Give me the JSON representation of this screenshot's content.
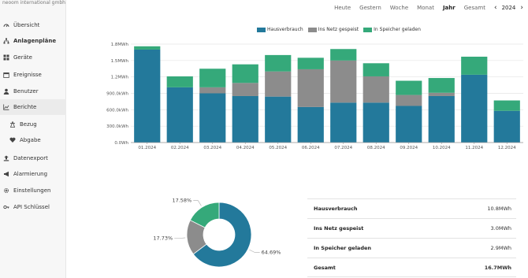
{
  "company": "neoom international gmbh",
  "nav": [
    {
      "label": "Übersicht",
      "icon": "gauge-icon",
      "name": "nav-uebersicht"
    },
    {
      "label": "Anlagenpläne",
      "icon": "sitemap-icon",
      "name": "nav-anlagenplaene",
      "bold": true
    },
    {
      "label": "Geräte",
      "icon": "grid-icon",
      "name": "nav-geraete"
    },
    {
      "label": "Ereignisse",
      "icon": "calendar-icon",
      "name": "nav-ereignisse"
    },
    {
      "label": "Benutzer",
      "icon": "user-icon",
      "name": "nav-benutzer"
    },
    {
      "label": "Berichte",
      "icon": "chart-icon",
      "name": "nav-berichte",
      "active": true
    },
    {
      "label": "Bezug",
      "icon": "tower-icon",
      "name": "nav-bezug",
      "sub": true
    },
    {
      "label": "Abgabe",
      "icon": "heart-icon",
      "name": "nav-abgabe",
      "sub": true
    },
    {
      "label": "Datenexport",
      "icon": "export-icon",
      "name": "nav-datenexport"
    },
    {
      "label": "Alarmierung",
      "icon": "megaphone-icon",
      "name": "nav-alarmierung"
    },
    {
      "label": "Einstellungen",
      "icon": "gear-icon",
      "name": "nav-einstellungen"
    },
    {
      "label": "API Schlüssel",
      "icon": "key-icon",
      "name": "nav-api-schluessel"
    }
  ],
  "period_tabs": [
    "Heute",
    "Gestern",
    "Woche",
    "Monat",
    "Jahr",
    "Gesamt"
  ],
  "active_tab": "Jahr",
  "year": "2024",
  "colors": {
    "hausverbrauch": "#23799b",
    "netz": "#8c8c8c",
    "speicher": "#35a97a"
  },
  "chart_data": {
    "type": "bar",
    "stacked": true,
    "categories": [
      "01.2024",
      "02.2024",
      "03.2024",
      "04.2024",
      "05.2024",
      "06.2024",
      "07.2024",
      "08.2024",
      "09.2024",
      "10.2024",
      "11.2024",
      "12.2024"
    ],
    "series": [
      {
        "name": "Hausverbrauch",
        "values": [
          1.7,
          1.01,
          0.9,
          0.85,
          0.84,
          0.65,
          0.73,
          0.73,
          0.67,
          0.85,
          1.24,
          0.58
        ]
      },
      {
        "name": "Ins Netz gespeist",
        "values": [
          0.0,
          0.0,
          0.11,
          0.24,
          0.46,
          0.69,
          0.77,
          0.48,
          0.2,
          0.06,
          0.0,
          0.0
        ]
      },
      {
        "name": "In Speicher geladen",
        "values": [
          0.06,
          0.2,
          0.34,
          0.34,
          0.3,
          0.21,
          0.21,
          0.24,
          0.26,
          0.27,
          0.33,
          0.19
        ]
      }
    ],
    "yticks": [
      "0.0Wh",
      "300.0kWh",
      "600.0kWh",
      "900.0kWh",
      "1.2MWh",
      "1.5MWh",
      "1.8MWh"
    ],
    "ylim": [
      0,
      1.8
    ],
    "yunit": "MWh",
    "legend_position": "top",
    "grid": true
  },
  "donut": {
    "slices": [
      {
        "label": "Hausverbrauch",
        "value": 64.69,
        "text": "64.69%"
      },
      {
        "label": "Ins Netz gespeist",
        "value": 17.73,
        "text": "17.73%"
      },
      {
        "label": "In Speicher geladen",
        "value": 17.58,
        "text": "17.58%"
      }
    ]
  },
  "summary": [
    {
      "label": "Hausverbrauch",
      "value": "10.8MWh"
    },
    {
      "label": "Ins Netz gespeist",
      "value": "3.0MWh"
    },
    {
      "label": "In Speicher geladen",
      "value": "2.9MWh"
    },
    {
      "label": "Gesamt",
      "value": "16.7MWh",
      "total": true
    }
  ]
}
